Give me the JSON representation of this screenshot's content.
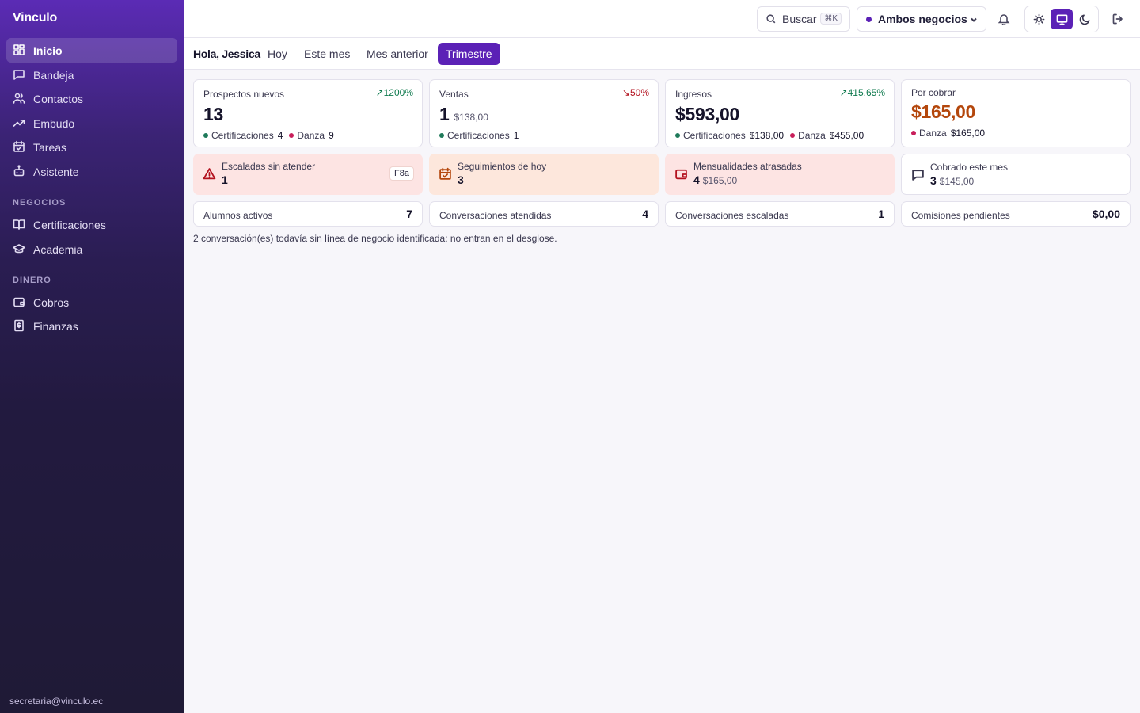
{
  "app": {
    "brand": "Vinculo"
  },
  "colors": {
    "accent": "#5b21b6",
    "success": "#0f7a4e",
    "danger": "#b3121f",
    "orange": "#b4470c",
    "dot_certificaciones": "#1f7a5a",
    "dot_danza": "#c81e5a"
  },
  "sidebar": {
    "items": [
      {
        "label": "Inicio",
        "icon": "dashboard-icon"
      },
      {
        "label": "Bandeja",
        "icon": "message-square-icon"
      },
      {
        "label": "Contactos",
        "icon": "users-icon"
      },
      {
        "label": "Embudo",
        "icon": "trending-up-icon"
      },
      {
        "label": "Tareas",
        "icon": "calendar-check-icon"
      },
      {
        "label": "Asistente",
        "icon": "bot-icon"
      }
    ],
    "section_negocios": "NEGOCIOS",
    "negocios": [
      {
        "label": "Certificaciones",
        "icon": "book-open-icon"
      },
      {
        "label": "Academia",
        "icon": "graduation-cap-icon"
      }
    ],
    "section_dinero": "DINERO",
    "dinero": [
      {
        "label": "Cobros",
        "icon": "wallet-icon"
      },
      {
        "label": "Finanzas",
        "icon": "receipt-dollar-icon"
      }
    ],
    "footer_email": "secretaria@vinculo.ec"
  },
  "header": {
    "search_label": "Buscar",
    "search_kbd": "⌘K",
    "business_select": "Ambos negocios"
  },
  "tabs": {
    "greeting": "Hola, Jessica",
    "items": [
      "Hoy",
      "Este mes",
      "Mes anterior",
      "Trimestre"
    ],
    "active": "Trimestre"
  },
  "kpis": {
    "prospectos": {
      "label": "Prospectos nuevos",
      "delta": "1200%",
      "value": "13",
      "b1_name": "Certificaciones",
      "b1_val": "4",
      "b2_name": "Danza",
      "b2_val": "9"
    },
    "ventas": {
      "label": "Ventas",
      "delta": "50%",
      "value": "1",
      "sub": "$138,00",
      "b1_name": "Certificaciones",
      "b1_val": "1"
    },
    "ingresos": {
      "label": "Ingresos",
      "delta": "415.65%",
      "value": "$593,00",
      "b1_name": "Certificaciones",
      "b1_val": "$138,00",
      "b2_name": "Danza",
      "b2_val": "$455,00"
    },
    "por_cobrar": {
      "label": "Por cobrar",
      "value": "$165,00",
      "b1_name": "Danza",
      "b1_val": "$165,00"
    }
  },
  "alerts": {
    "escaladas": {
      "label": "Escaladas sin atender",
      "value": "1",
      "tag": "F8a"
    },
    "seguimientos": {
      "label": "Seguimientos de hoy",
      "value": "3"
    },
    "mensualidades": {
      "label": "Mensualidades atrasadas",
      "value": "4",
      "sub": "$165,00"
    },
    "cobrado": {
      "label": "Cobrado este mes",
      "value": "3",
      "sub": "$145,00"
    }
  },
  "stats": {
    "alumnos": {
      "label": "Alumnos activos",
      "value": "7"
    },
    "atendidas": {
      "label": "Conversaciones atendidas",
      "value": "4"
    },
    "escaladas": {
      "label": "Conversaciones escaladas",
      "value": "1"
    },
    "comisiones": {
      "label": "Comisiones pendientes",
      "value": "$0,00"
    }
  },
  "note": "2 conversación(es) todavía sin línea de negocio identificada: no entran en el desglose."
}
